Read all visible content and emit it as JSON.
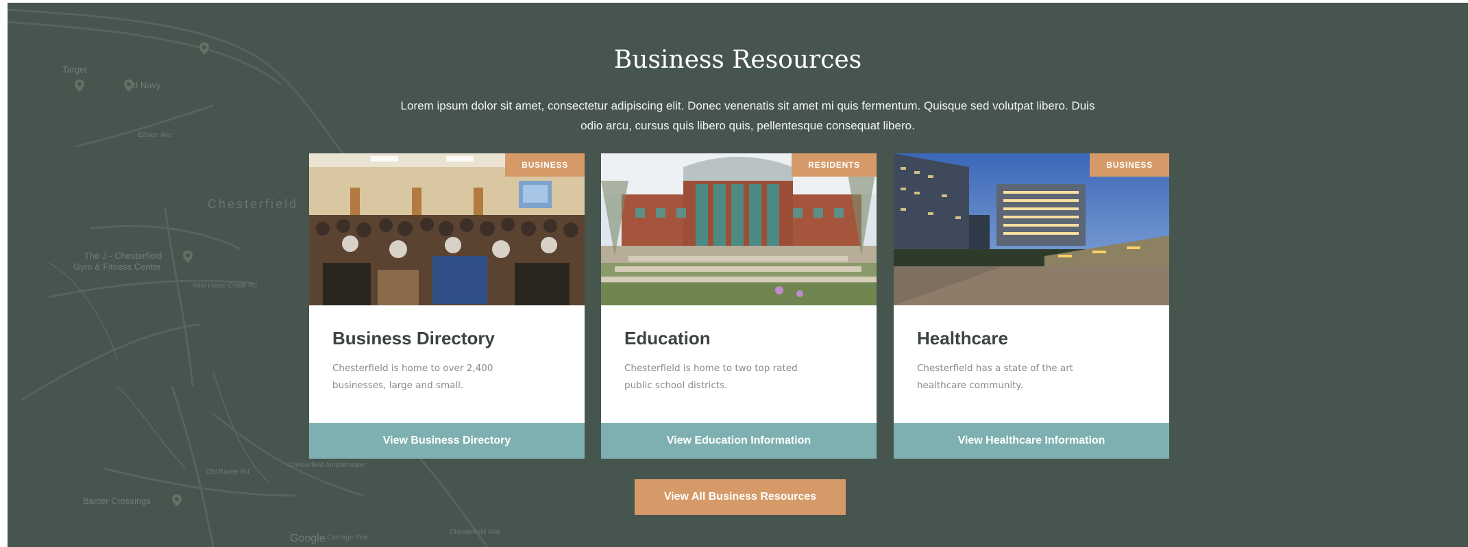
{
  "section": {
    "title": "Business Resources",
    "intro": "Lorem ipsum dolor sit amet, consectetur adipiscing elit. Donec venenatis sit amet mi quis fermentum. Quisque sed volutpat libero. Duis odio arcu, cursus quis libero quis, pellentesque consequat libero."
  },
  "cards": [
    {
      "badge": "BUSINESS",
      "title": "Business Directory",
      "text": "Chesterfield is home to over 2,400 businesses, large and small.",
      "button": "View Business Directory",
      "image": "conference-audience-photo"
    },
    {
      "badge": "RESIDENTS",
      "title": "Education",
      "text": "Chesterfield is home to two top rated public school districts.",
      "button": "View Education Information",
      "image": "school-building-photo"
    },
    {
      "badge": "BUSINESS",
      "title": "Healthcare",
      "text": "Chesterfield has a state of the art healthcare community.",
      "button": "View Healthcare Information",
      "image": "hospital-campus-photo"
    }
  ],
  "all_button": "View All Business Resources",
  "map": {
    "labels": [
      "Target",
      "Old Navy",
      "Chesterfield",
      "The J - Chesterfield",
      "Gym & Fitness Center",
      "Baxter Crossings",
      "Google",
      "Edison Ave",
      "Wild Horse Creek Rd",
      "Old Baxter Rd",
      "Chesterfield Amphitheater",
      "Chesterfield Mall",
      "Carriage Pine"
    ]
  },
  "colors": {
    "background": "#47554f",
    "badge": "#d69a68",
    "card_button": "#7fb0b1",
    "all_button": "#d69a68"
  }
}
